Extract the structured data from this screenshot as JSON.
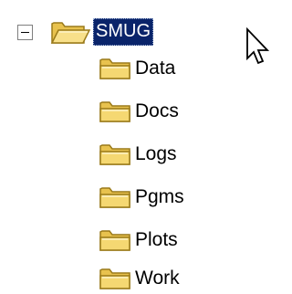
{
  "tree": {
    "root": {
      "label": "SMUG",
      "expanded": true,
      "selected": true,
      "icon": "folder-open-icon"
    },
    "children": [
      {
        "label": "Data",
        "icon": "folder-icon"
      },
      {
        "label": "Docs",
        "icon": "folder-icon"
      },
      {
        "label": "Logs",
        "icon": "folder-icon"
      },
      {
        "label": "Pgms",
        "icon": "folder-icon"
      },
      {
        "label": "Plots",
        "icon": "folder-icon"
      },
      {
        "label": "Work",
        "icon": "folder-icon"
      }
    ]
  },
  "colors": {
    "selection_background": "#0a246a",
    "selection_text": "#ffffff",
    "folder_fill": "#f5d872",
    "folder_outline": "#9a7a1a"
  },
  "cursor": {
    "icon": "arrow-cursor-icon"
  }
}
